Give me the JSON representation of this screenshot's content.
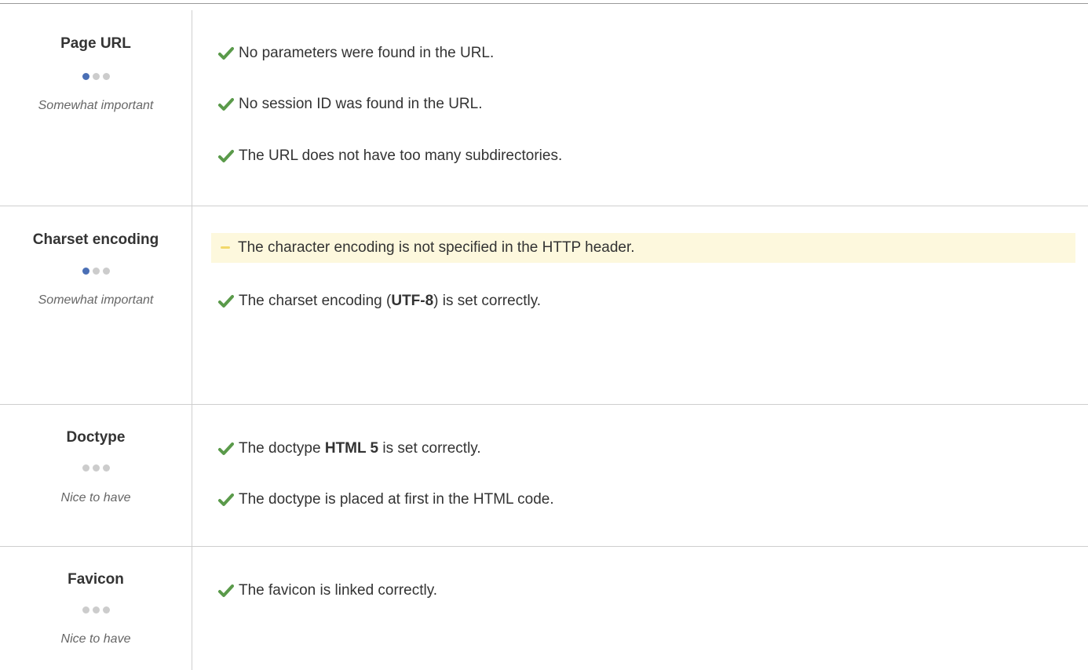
{
  "sections": [
    {
      "title": "Page URL",
      "dots_on": 1,
      "importance": "Somewhat important",
      "messages": [
        {
          "status": "ok",
          "parts": [
            "No parameters were found in the URL."
          ]
        },
        {
          "status": "ok",
          "parts": [
            "No session ID was found in the URL."
          ]
        },
        {
          "status": "ok",
          "parts": [
            "The URL does not have too many subdirectories."
          ]
        }
      ]
    },
    {
      "title": "Charset encoding",
      "dots_on": 1,
      "importance": "Somewhat important",
      "messages": [
        {
          "status": "warning",
          "parts": [
            "The character encoding is not specified in the HTTP header."
          ]
        },
        {
          "status": "ok",
          "parts": [
            "The charset encoding (",
            "UTF-8",
            ") is set correctly."
          ]
        }
      ]
    },
    {
      "title": "Doctype",
      "dots_on": 0,
      "importance": "Nice to have",
      "messages": [
        {
          "status": "ok",
          "parts": [
            "The doctype ",
            "HTML 5",
            " is set correctly."
          ]
        },
        {
          "status": "ok",
          "parts": [
            "The doctype is placed at first in the HTML code."
          ]
        }
      ]
    },
    {
      "title": "Favicon",
      "dots_on": 0,
      "importance": "Nice to have",
      "messages": [
        {
          "status": "ok",
          "parts": [
            "The favicon is linked correctly."
          ]
        }
      ]
    }
  ],
  "colors": {
    "ok_check": "#5a9a4a",
    "warning_dash": "#f2d86a",
    "warning_bg": "#fdf8dd",
    "dot_active": "#4a6fb5",
    "dot_inactive": "#cccccc"
  }
}
